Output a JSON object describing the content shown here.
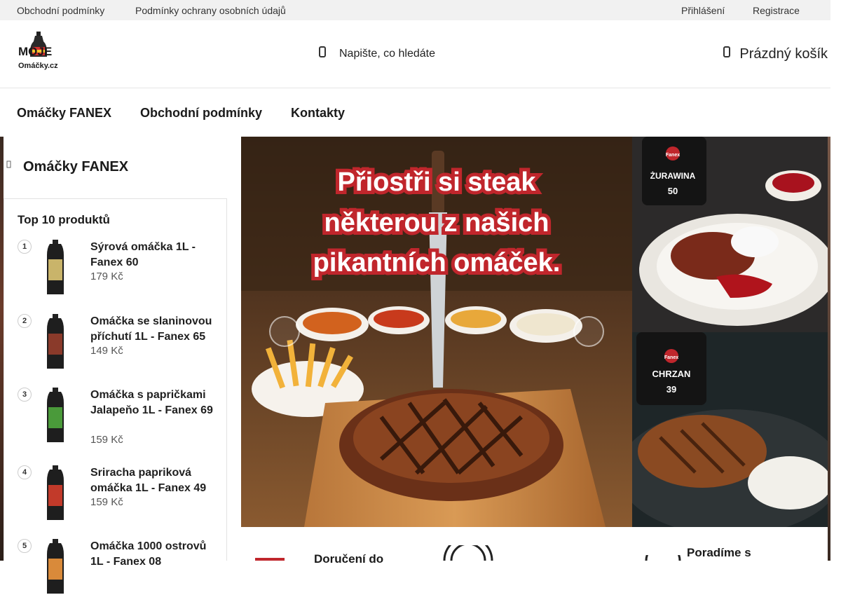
{
  "topbar": {
    "links_left": [
      "Obchodní podmínky",
      "Podmínky ochrany osobních údajů"
    ],
    "login": "Přihlášení",
    "register": "Registrace"
  },
  "header": {
    "logo_text_top": "MOJE",
    "logo_text_bottom": "Omáčky.cz",
    "search_placeholder": "Napište, co hledáte",
    "cart_label": "Prázdný košík"
  },
  "nav": {
    "items": [
      "Omáčky FANEX",
      "Obchodní podmínky",
      "Kontakty"
    ]
  },
  "sidebar": {
    "category": "Omáčky FANEX",
    "top10_title": "Top 10 produktů",
    "products": [
      {
        "rank": "1",
        "name": "Sýrová omáčka 1L - Fanex 60",
        "price": "179 Kč",
        "label_color": "#c9b46a"
      },
      {
        "rank": "2",
        "name": "Omáčka se slaninovou příchutí 1L - Fanex 65",
        "price": "149 Kč",
        "label_color": "#8a3a2a"
      },
      {
        "rank": "3",
        "name": "Omáčka s papričkami Jalapeňo 1L - Fanex 69",
        "price": "159 Kč",
        "label_color": "#4a9a3a"
      },
      {
        "rank": "4",
        "name": "Sriracha papriková omáčka 1L - Fanex 49",
        "price": "159 Kč",
        "label_color": "#c23a2a"
      },
      {
        "rank": "5",
        "name": "Omáčka 1000 ostrovů 1L - Fanex 08",
        "price": "",
        "label_color": "#d98a3a"
      }
    ]
  },
  "banner": {
    "headline_lines": [
      "Přiostři si steak",
      "některou z našich",
      "pikantních omáček."
    ]
  },
  "side_images": {
    "top_jar": {
      "brand": "Fanex",
      "product": "ŻURAWINA",
      "number": "50"
    },
    "bottom_jar": {
      "brand": "Fanex",
      "product": "CHRZAN",
      "number": "39"
    }
  },
  "features": {
    "delivery": "Doručení do",
    "advice": "Poradíme s"
  },
  "colors": {
    "accent": "#c0262c",
    "topbar_bg": "#f1f1f1",
    "text": "#1a1a1a"
  }
}
